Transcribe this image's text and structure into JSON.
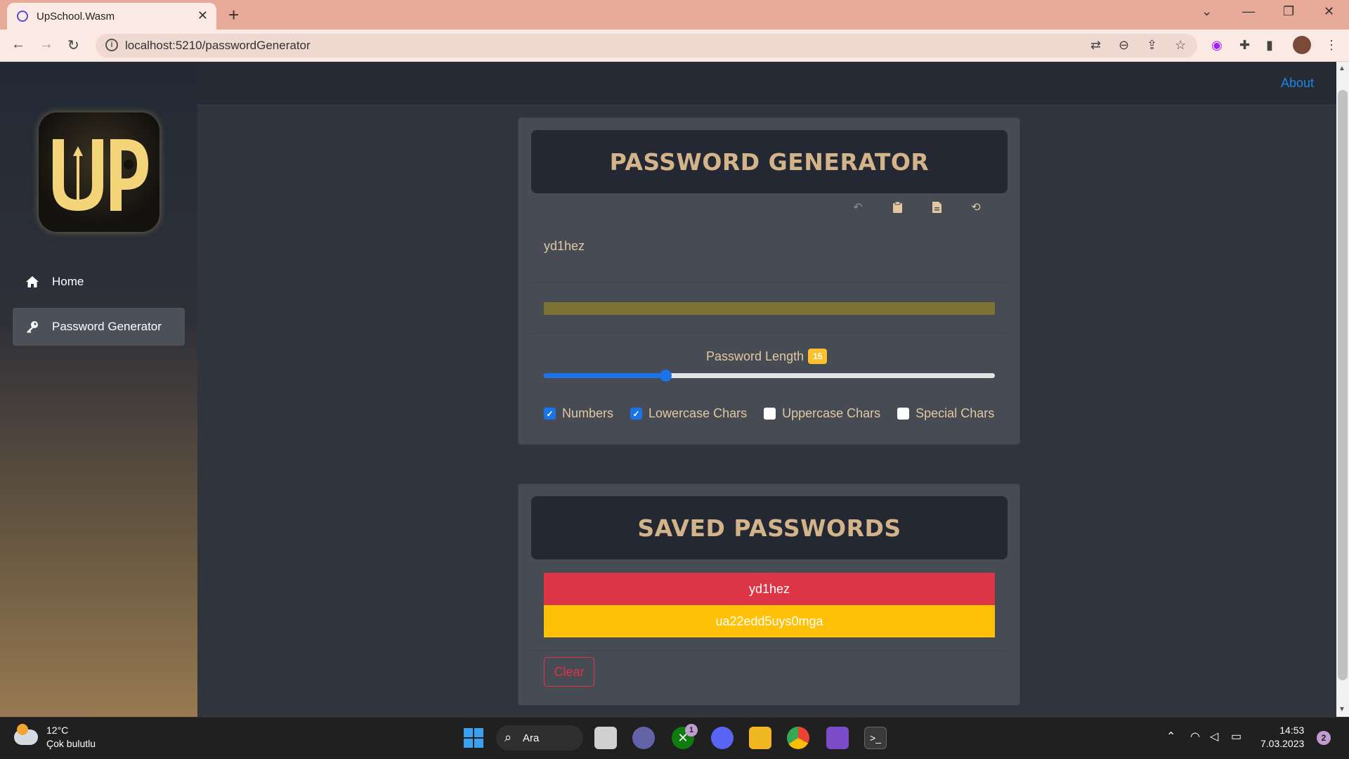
{
  "browser": {
    "tab_title": "UpSchool.Wasm",
    "url": "localhost:5210/passwordGenerator"
  },
  "topnav": {
    "about_label": "About"
  },
  "sidebar": {
    "items": [
      {
        "label": "Home",
        "icon": "home-icon",
        "active": false
      },
      {
        "label": "Password Generator",
        "icon": "key-icon",
        "active": true
      }
    ]
  },
  "generator": {
    "title": "PASSWORD GENERATOR",
    "password": "yd1hez",
    "strength_color": "#7d7234",
    "length_label": "Password Length",
    "length_value": "15",
    "length_fraction": 0.27,
    "options": [
      {
        "label": "Numbers",
        "checked": true
      },
      {
        "label": "Lowercase Chars",
        "checked": true
      },
      {
        "label": "Uppercase Chars",
        "checked": false
      },
      {
        "label": "Special Chars",
        "checked": false
      }
    ],
    "action_icons": [
      "undo-icon",
      "clipboard-icon",
      "save-file-icon",
      "refresh-icon"
    ]
  },
  "saved": {
    "title": "SAVED PASSWORDS",
    "items": [
      {
        "value": "yd1hez",
        "color": "#dc3545"
      },
      {
        "value": "ua22edd5uys0mga",
        "color": "#ffc107"
      }
    ],
    "clear_label": "Clear"
  },
  "taskbar": {
    "temperature": "12°C",
    "weather": "Çok bulutlu",
    "search_label": "Ara",
    "xbox_badge": "1",
    "time": "14:53",
    "date": "7.03.2023",
    "notification_count": "2"
  },
  "colors": {
    "accent": "#1a73e8",
    "heading": "#d3b48a",
    "danger": "#dc3545",
    "warning": "#ffc107"
  }
}
